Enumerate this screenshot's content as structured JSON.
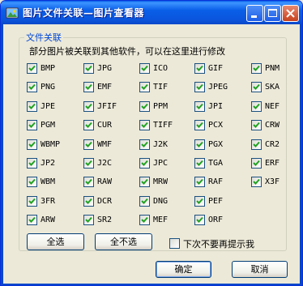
{
  "window": {
    "title": "图片文件关联—图片查看器"
  },
  "group": {
    "title": "文件关联",
    "description": "部分图片被关联到其他软件，可以在这里进行修改"
  },
  "formats": [
    "BMP",
    "JPG",
    "ICO",
    "GIF",
    "PNM",
    "PNG",
    "EMF",
    "TIF",
    "JPEG",
    "SKA",
    "JPE",
    "JFIF",
    "PPM",
    "JPI",
    "NEF",
    "PGM",
    "CUR",
    "TIFF",
    "PCX",
    "CRW",
    "WBMP",
    "WMF",
    "J2K",
    "PGX",
    "CR2",
    "JP2",
    "J2C",
    "JPC",
    "TGA",
    "ERF",
    "WBM",
    "RAW",
    "MRW",
    "RAF",
    "X3F",
    "3FR",
    "DCR",
    "DNG",
    "PEF",
    "ARW",
    "SR2",
    "MEF",
    "ORF"
  ],
  "buttons": {
    "select_all": "全选",
    "select_none": "全不选",
    "ok": "确定",
    "cancel": "取消"
  },
  "dont_prompt": {
    "label": "下次不要再提示我",
    "checked": false
  }
}
